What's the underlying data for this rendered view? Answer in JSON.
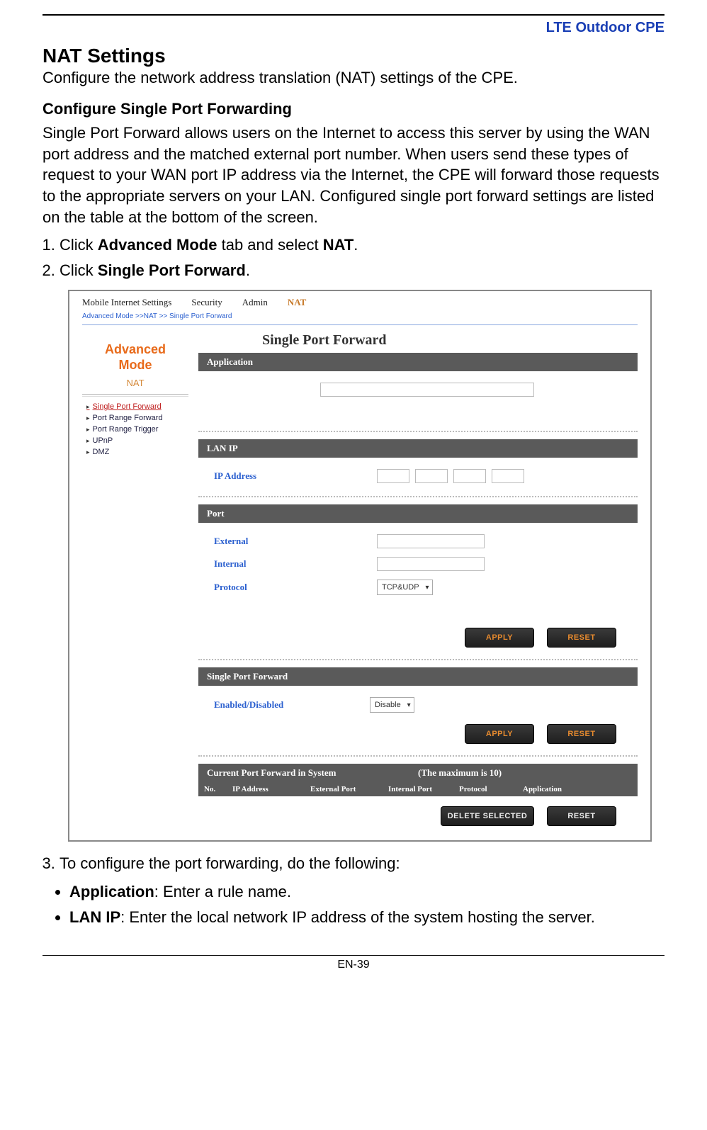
{
  "brand": "LTE Outdoor CPE",
  "heading": "NAT Settings",
  "subtitle": "Configure the network address translation (NAT) settings of the CPE.",
  "section1": "Configure Single Port Forwarding",
  "section1_body": "Single Port Forward allows users on the Internet to access this server by using the WAN port address and the matched external port number. When users send these types of request to your WAN port IP address via the Internet, the CPE will forward those requests to the appropriate servers on your LAN. Configured single port forward settings are listed on the table at the bottom of the screen.",
  "steps": {
    "s1_pre": "Click ",
    "s1_b1": "Advanced Mode",
    "s1_mid": " tab and select ",
    "s1_b2": "NAT",
    "s1_post": ".",
    "s2_pre": "Click ",
    "s2_b1": "Single Port Forward",
    "s2_post": "."
  },
  "screenshot": {
    "tabs": {
      "t1": "Mobile Internet Settings",
      "t2": "Security",
      "t3": "Admin",
      "t4": "NAT"
    },
    "crumb": "Advanced Mode >>NAT >> Single Port Forward",
    "adv_line1": "Advanced",
    "adv_line2": "Mode",
    "nat": "NAT",
    "nav": {
      "n1": "Single Port Forward",
      "n2": "Port Range Forward",
      "n3": "Port Range Trigger",
      "n4": "UPnP",
      "n5": "DMZ"
    },
    "title": "Single Port Forward",
    "application_hdr": "Application",
    "lanip_hdr": "LAN IP",
    "ip_label": "IP Address",
    "port_hdr": "Port",
    "external": "External",
    "internal": "Internal",
    "protocol": "Protocol",
    "protocol_val": "TCP&UDP",
    "apply": "APPLY",
    "reset": "RESET",
    "spf_hdr": "Single Port Forward",
    "enabled_label": "Enabled/Disabled",
    "enabled_val": "Disable",
    "cpf_hdr_left": "Current Port Forward in System",
    "cpf_hdr_right": "(The maximum is 10)",
    "th": {
      "c1": "No.",
      "c2": "IP Address",
      "c3": "External Port",
      "c4": "Internal Port",
      "c5": "Protocol",
      "c6": "Application"
    },
    "del": "DELETE SELECTED"
  },
  "step3": "To configure the port forwarding, do the following:",
  "bullets": {
    "b1_b": "Application",
    "b1_t": ": Enter a rule name.",
    "b2_b": "LAN IP",
    "b2_t": ": Enter the local network IP address of the system hosting the server."
  },
  "page_num": "EN-39"
}
